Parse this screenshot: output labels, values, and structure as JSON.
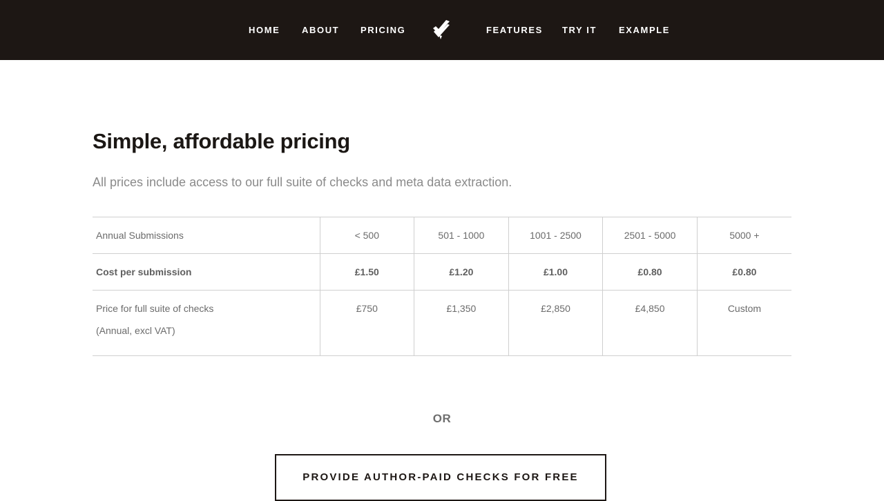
{
  "nav": {
    "left_links": [
      "HOME",
      "ABOUT",
      "PRICING"
    ],
    "right_links": [
      "FEATURES",
      "TRY IT",
      "EXAMPLE"
    ],
    "logo_icon": "checkmark-logo-icon"
  },
  "main": {
    "title": "Simple, affordable pricing",
    "subtitle": "All prices include access to our full suite of checks and meta data extraction."
  },
  "pricing_table": {
    "rows": [
      {
        "label": "Annual Submissions",
        "values": [
          "< 500",
          "501 - 1000",
          "1001 - 2500",
          "2501 - 5000",
          "5000 +"
        ]
      },
      {
        "label": "Cost per submission",
        "values": [
          "£1.50",
          "£1.20",
          "£1.00",
          "£0.80",
          "£0.80"
        ]
      },
      {
        "label": "Price for full suite of checks",
        "label_note": "(Annual, excl VAT)",
        "values": [
          "£750",
          "£1,350",
          "£2,850",
          "£4,850",
          "Custom"
        ]
      }
    ]
  },
  "or_text": "OR",
  "cta": {
    "label": "PROVIDE AUTHOR-PAID CHECKS FOR FREE"
  },
  "colors": {
    "nav_bg": "#1d1714",
    "title": "#1b1714",
    "muted_text": "#8a8a8a",
    "table_border": "#cfcfcf"
  }
}
